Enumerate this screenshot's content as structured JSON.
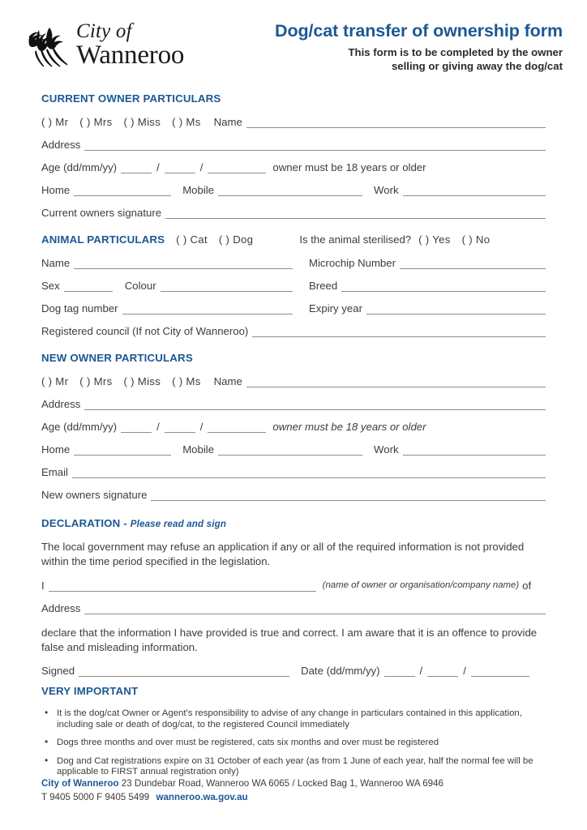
{
  "header": {
    "logo_icon": "grasstree-logo-icon",
    "logo_line1": "City of",
    "logo_line2": "Wanneroo",
    "title": "Dog/cat transfer of ownership form",
    "subtitle_line1": "This form is to be completed by the owner",
    "subtitle_line2": "selling or giving away the dog/cat",
    "accent_color": "#1c5894"
  },
  "current_owner": {
    "heading": "CURRENT OWNER PARTICULARS",
    "titles": [
      "(  )  Mr",
      "(  )  Mrs",
      "(  )  Miss",
      "(  )  Ms"
    ],
    "name_label": "Name",
    "address_label": "Address",
    "age_label": "Age (dd/mm/yy)",
    "slash": "/",
    "age_note": "owner must be 18 years or older",
    "home_label": "Home",
    "mobile_label": "Mobile",
    "work_label": "Work",
    "signature_label": "Current owners signature"
  },
  "animal": {
    "heading": "ANIMAL PARTICULARS",
    "species": [
      "(  )  Cat",
      "(  )  Dog"
    ],
    "sterilised_question": "Is the animal sterilised?",
    "sterilised_options": [
      "(  )  Yes",
      "(  )  No"
    ],
    "name_label": "Name",
    "microchip_label": "Microchip Number",
    "sex_label": "Sex",
    "colour_label": "Colour",
    "breed_label": "Breed",
    "tag_label": "Dog tag number",
    "expiry_label": "Expiry year",
    "council_label": "Registered council (If not City of Wanneroo)"
  },
  "new_owner": {
    "heading": "NEW OWNER PARTICULARS",
    "titles": [
      "(  )  Mr",
      "(  )  Mrs",
      "(  )  Miss",
      "(  )  Ms"
    ],
    "name_label": "Name",
    "address_label": "Address",
    "age_label": "Age (dd/mm/yy)",
    "slash": "/",
    "age_note": "owner must be 18 years or older",
    "home_label": "Home",
    "mobile_label": "Mobile",
    "work_label": "Work",
    "email_label": "Email",
    "signature_label": "New owners signature"
  },
  "declaration": {
    "heading": "DECLARATION -",
    "heading_sub": "Please read and sign",
    "paragraph": "The local government may refuse an application if any or all of the required information is not provided within the time period specified in the legislation.",
    "i_label": "I",
    "i_note": "(name of owner or organisation/company name)",
    "of_label": "of",
    "address_label": "Address",
    "declare_paragraph": "declare that the information I have provided is true and correct. I am aware that it is an offence to provide false and misleading information.",
    "signed_label": "Signed",
    "date_label": "Date (dd/mm/yy)",
    "slash": "/"
  },
  "very_important": {
    "heading": "VERY IMPORTANT",
    "bullets": [
      "It is the dog/cat Owner or Agent's responsibility to advise of any change in particulars contained in this application, including sale or death of dog/cat, to the registered Council immediately",
      "Dogs three months and over must be registered, cats six months and over must be registered",
      "Dog and Cat registrations expire on 31 October of each year (as from 1 June of each year, half the normal fee will be applicable to FIRST annual registration only)"
    ]
  },
  "footer": {
    "org": "City of Wanneroo",
    "address": "23 Dundebar Road, Wanneroo WA 6065 / Locked Bag 1, Wanneroo WA 6946",
    "phone": "T 9405 5000  F 9405 5499",
    "url": "wanneroo.wa.gov.au"
  }
}
